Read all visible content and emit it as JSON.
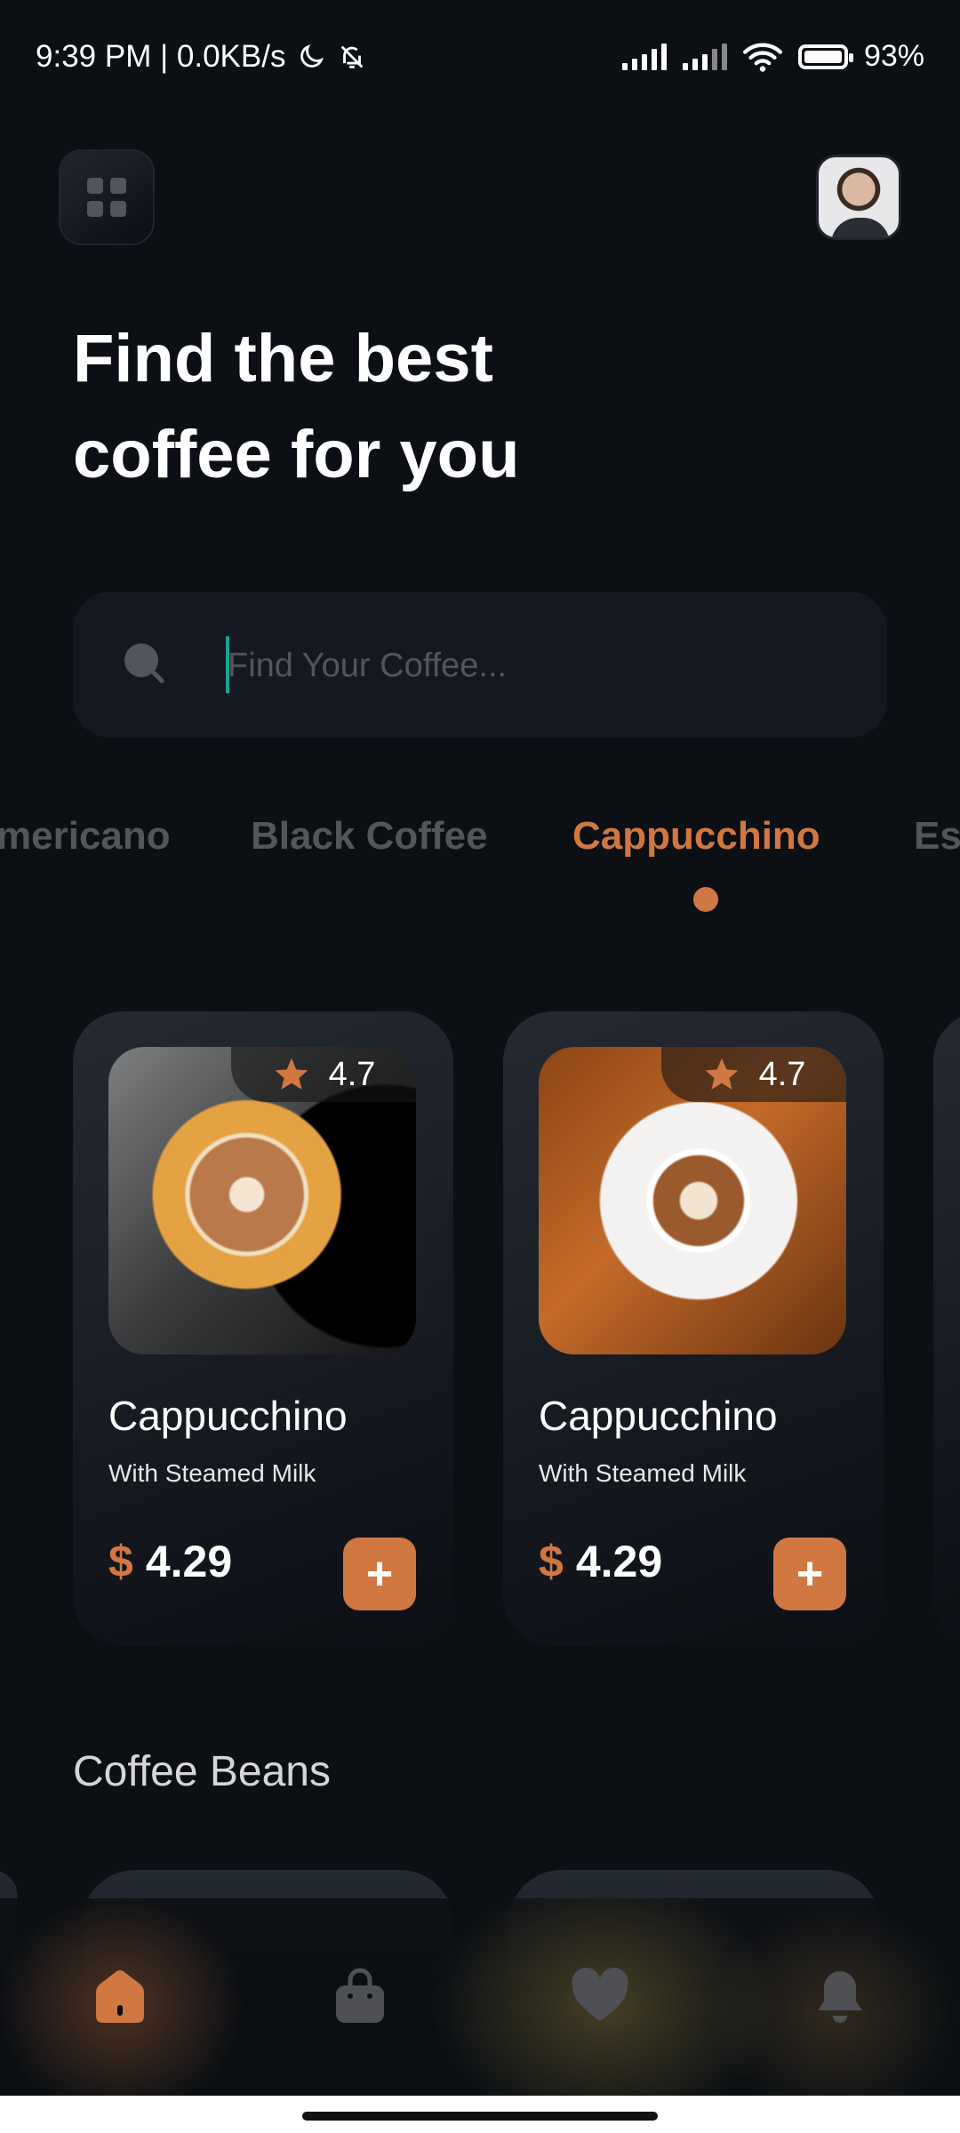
{
  "status_bar": {
    "time_speed": "9:39 PM | 0.0KB/s",
    "battery": "93%"
  },
  "header": {
    "headline_line1": "Find the best",
    "headline_line2": "coffee for you"
  },
  "search": {
    "placeholder": "Find Your Coffee..."
  },
  "categories": {
    "items": [
      "mericano",
      "Black Coffee",
      "Cappucchino",
      "Esp"
    ],
    "active": "Cappucchino"
  },
  "products": [
    {
      "rating": "4.7",
      "name": "Cappucchino",
      "subtitle": "With Steamed Milk",
      "currency": "$",
      "price": "4.29",
      "add_label": "+"
    },
    {
      "rating": "4.7",
      "name": "Cappucchino",
      "subtitle": "With Steamed Milk",
      "currency": "$",
      "price": "4.29",
      "add_label": "+"
    }
  ],
  "sections": {
    "coffee_beans": "Coffee Beans"
  },
  "nav": {
    "items": [
      "home-icon",
      "bag-icon",
      "heart-icon",
      "bell-icon"
    ],
    "active": "home-icon"
  },
  "colors": {
    "background": "#0c0f14",
    "accent": "#d17842",
    "muted": "#52555a",
    "card": "#252a32"
  }
}
